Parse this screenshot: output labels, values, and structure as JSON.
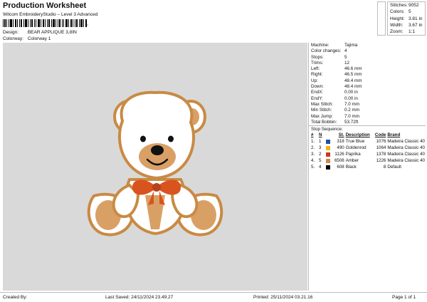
{
  "header": {
    "title": "Production Worksheet",
    "subtitle": "Wilcom EmbroideryStudio – Level 3 Advanced",
    "barcode_suffix": ",",
    "design_label": "Design:",
    "design_value": "BEAR APPLIQUE 3,8IN",
    "colorway_label": "Colorway:",
    "colorway_value": "Colorway 1"
  },
  "summary": {
    "stitches_label": "Stitches:",
    "stitches_value": "9052",
    "colors_label": "Colors:",
    "colors_value": "5",
    "height_label": "Height:",
    "height_value": "3.81 in",
    "width_label": "Width:",
    "width_value": "3.67 in",
    "zoom_label": "Zoom:",
    "zoom_value": "1:1"
  },
  "machine_info": [
    {
      "label": "Machine:",
      "value": "Tajima"
    },
    {
      "label": "Color changes:",
      "value": "4"
    },
    {
      "label": "Stops:",
      "value": "5"
    },
    {
      "label": "Trims:",
      "value": "12"
    },
    {
      "label": "Left:",
      "value": "46.6 mm"
    },
    {
      "label": "Right:",
      "value": "46.5 mm"
    },
    {
      "label": "Up:",
      "value": "48.4 mm"
    },
    {
      "label": "Down:",
      "value": "48.4 mm"
    },
    {
      "label": "EndX:",
      "value": "0.00 in"
    },
    {
      "label": "EndY:",
      "value": "0.00 in"
    },
    {
      "label": "Max Stitch:",
      "value": "7.0 mm"
    },
    {
      "label": "Min Stitch:",
      "value": "0.2 mm"
    },
    {
      "label": "Max Jump:",
      "value": "7.0 mm"
    },
    {
      "label": "Total Bobbin:",
      "value": "53.72ft"
    }
  ],
  "stop_sequence": {
    "title": "Stop Sequence:",
    "headers": [
      "#",
      "N",
      "St.",
      "Description",
      "Code",
      "Brand"
    ],
    "rows": [
      {
        "num": "1.",
        "n": "1",
        "color": "#1f4fa8",
        "st": "318",
        "desc": "True Blue",
        "code": "1076",
        "brand": "Madeira Classic 40"
      },
      {
        "num": "2.",
        "n": "3",
        "color": "#e8b817",
        "st": "490",
        "desc": "Goldenrod",
        "code": "1064",
        "brand": "Madeira Classic 40"
      },
      {
        "num": "3.",
        "n": "2",
        "color": "#c83a1e",
        "st": "1126",
        "desc": "Paprika",
        "code": "1378",
        "brand": "Madeira Classic 40"
      },
      {
        "num": "4.",
        "n": "5",
        "color": "#c9894a",
        "st": "6508",
        "desc": "Amber",
        "code": "1226",
        "brand": "Madeira Classic 40"
      },
      {
        "num": "5.",
        "n": "4",
        "color": "#000000",
        "st": "608",
        "desc": "Black",
        "code": "8",
        "brand": "Default"
      }
    ]
  },
  "footer": {
    "created_by": "Created By:",
    "last_saved": "Last Saved: 24/11/2024 23.49.27",
    "printed": "Printed: 25/11/2024 03.21.16",
    "page": "Page 1 of 1"
  },
  "colors": {
    "canvas_bg": "#d9d9d9",
    "outline": "#c98a44",
    "fill": "#d9a066",
    "bow": "#d9531e"
  }
}
